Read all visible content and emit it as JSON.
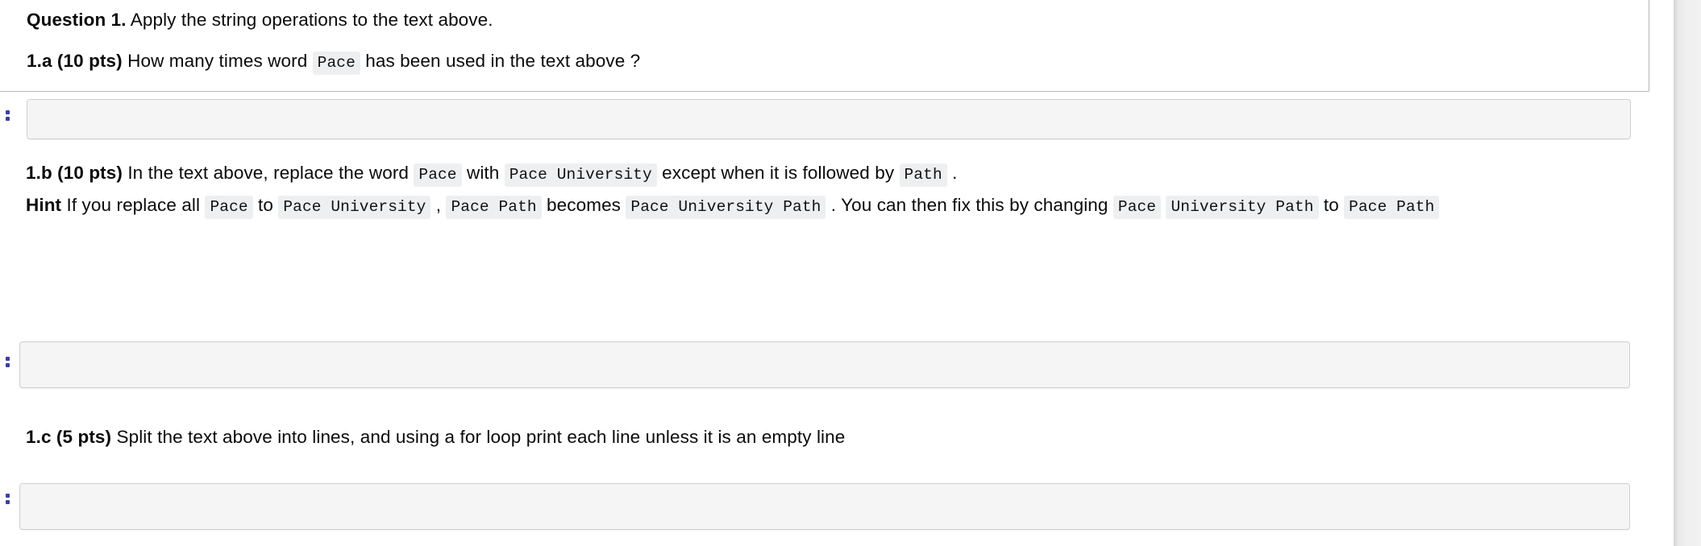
{
  "notebook": {
    "markdown_cell": {
      "question_heading": {
        "label": "Question 1.",
        "text": " Apply the string operations to the text above."
      },
      "part_a": {
        "label": "1.a (10 pts)",
        "text_before": " How many times word ",
        "code_1": "Pace",
        "text_after": " has been used in the text above ?"
      }
    },
    "part_b": {
      "label": "1.b (10 pts)",
      "t1": " In the text above, replace the word ",
      "code_1": "Pace",
      "t2": " with ",
      "code_2": "Pace University",
      "t3": " except when it is followed by ",
      "code_3": "Path",
      "t4": " .",
      "hint_label": "Hint",
      "h1": " If you replace all ",
      "hcode_1": "Pace",
      "h2": " to ",
      "hcode_2": "Pace University",
      "h3": " , ",
      "hcode_3": "Pace Path",
      "h4": " becomes ",
      "hcode_4": "Pace University Path",
      "h5": " . You can then fix this by changing ",
      "hcode_5": "Pace",
      "h6": " ",
      "hcode_6": "University Path",
      "h7": " to ",
      "hcode_7": "Pace Path"
    },
    "part_c": {
      "label": "1.c (5 pts)",
      "text": " Split the text above into lines, and using a for loop print each line unless it is an empty line"
    },
    "code_cells": [
      {
        "name": "code-cell-a",
        "content": ""
      },
      {
        "name": "code-cell-b",
        "content": ""
      },
      {
        "name": "code-cell-c",
        "content": ""
      }
    ],
    "colors": {
      "drag_handle": "#3b3fa0",
      "code_span_bg": "#eeeff1",
      "code_cell_bg": "#f5f5f5",
      "code_cell_border": "#cfcfcf",
      "markdown_cell_border": "#b5b5b5"
    }
  }
}
